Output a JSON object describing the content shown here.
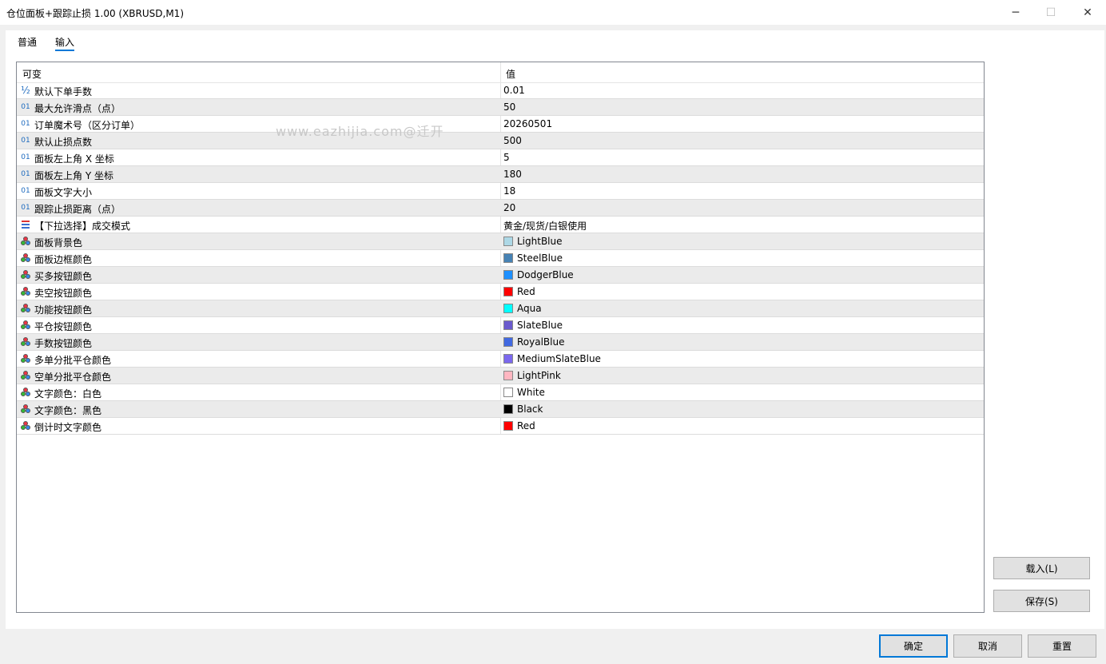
{
  "window": {
    "title": "仓位面板+跟踪止损 1.00 (XBRUSD,M1)",
    "controls": {
      "minimize": "─",
      "maximize": "☐",
      "close": "✕"
    }
  },
  "tabs": [
    {
      "label": "普通",
      "active": false
    },
    {
      "label": "输入",
      "active": true
    }
  ],
  "table": {
    "headers": {
      "variable": "可变",
      "value": "值"
    },
    "rows": [
      {
        "icon": "fraction-icon",
        "icon_text": "½",
        "name": "默认下单手数",
        "value": "0.01"
      },
      {
        "icon": "integer-icon",
        "icon_text": "01",
        "name": "最大允许滑点（点）",
        "value": "50"
      },
      {
        "icon": "integer-icon",
        "icon_text": "01",
        "name": "订单魔术号（区分订单）",
        "value": "20260501"
      },
      {
        "icon": "integer-icon",
        "icon_text": "01",
        "name": "默认止损点数",
        "value": "500"
      },
      {
        "icon": "integer-icon",
        "icon_text": "01",
        "name": "面板左上角 X 坐标",
        "value": "5"
      },
      {
        "icon": "integer-icon",
        "icon_text": "01",
        "name": "面板左上角 Y 坐标",
        "value": "180"
      },
      {
        "icon": "integer-icon",
        "icon_text": "01",
        "name": "面板文字大小",
        "value": "18"
      },
      {
        "icon": "integer-icon",
        "icon_text": "01",
        "name": "跟踪止损距离（点）",
        "value": "20"
      },
      {
        "icon": "enum-list-icon",
        "icon_text": "",
        "name": "【下拉选择】成交模式",
        "value": "黄金/现货/白银使用"
      },
      {
        "icon": "color-icon",
        "name": "面板背景色",
        "value": "LightBlue",
        "color": "#ADD8E6"
      },
      {
        "icon": "color-icon",
        "name": "面板边框颜色",
        "value": "SteelBlue",
        "color": "#4682B4"
      },
      {
        "icon": "color-icon",
        "name": "买多按钮颜色",
        "value": "DodgerBlue",
        "color": "#1E90FF"
      },
      {
        "icon": "color-icon",
        "name": "卖空按钮颜色",
        "value": "Red",
        "color": "#FF0000"
      },
      {
        "icon": "color-icon",
        "name": "功能按钮颜色",
        "value": "Aqua",
        "color": "#00FFFF"
      },
      {
        "icon": "color-icon",
        "name": "平仓按钮颜色",
        "value": "SlateBlue",
        "color": "#6A5ACD"
      },
      {
        "icon": "color-icon",
        "name": "手数按钮颜色",
        "value": "RoyalBlue",
        "color": "#4169E1"
      },
      {
        "icon": "color-icon",
        "name": "多单分批平仓颜色",
        "value": "MediumSlateBlue",
        "color": "#7B68EE"
      },
      {
        "icon": "color-icon",
        "name": "空单分批平仓颜色",
        "value": "LightPink",
        "color": "#FFB6C1"
      },
      {
        "icon": "color-icon",
        "name": "文字颜色：白色",
        "value": "White",
        "color": "#FFFFFF"
      },
      {
        "icon": "color-icon",
        "name": "文字颜色：黑色",
        "value": "Black",
        "color": "#000000"
      },
      {
        "icon": "color-icon",
        "name": "倒计时文字颜色",
        "value": "Red",
        "color": "#FF0000"
      }
    ]
  },
  "watermark": "www.eazhijia.com@迁开",
  "side_buttons": {
    "load": "载入(L)",
    "save": "保存(S)"
  },
  "footer_buttons": {
    "ok": "确定",
    "cancel": "取消",
    "reset": "重置"
  },
  "colors": {
    "accent": "#0078d7",
    "alt_row": "#ebebeb"
  }
}
